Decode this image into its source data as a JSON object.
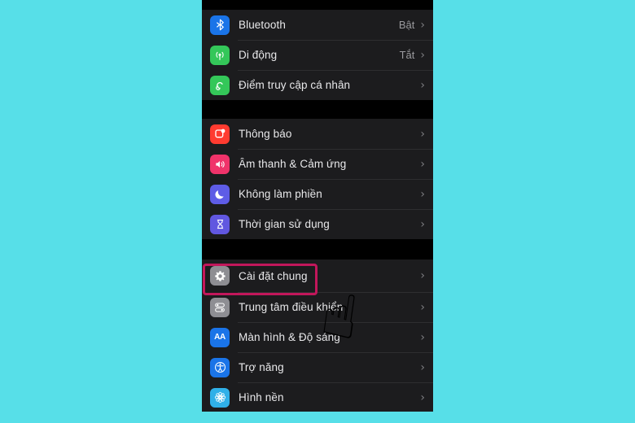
{
  "background": {
    "color": "#57dfe8"
  },
  "phone": {
    "panel_bg": "#000000",
    "group_bg": "#1c1c1e",
    "groups": [
      {
        "name": "connectivity",
        "rows": [
          {
            "label": "Bluetooth",
            "value": "Bật",
            "icon": "bluetooth-icon",
            "icon_color": "#1a74e8",
            "chevron": "›"
          },
          {
            "label": "Di động",
            "value": "Tắt",
            "icon": "cellular-icon",
            "icon_color": "#34c759",
            "chevron": "›"
          },
          {
            "label": "Điểm truy cập cá nhân",
            "value": "",
            "icon": "personal-hotspot-icon",
            "icon_color": "#34c759",
            "chevron": "›"
          }
        ]
      },
      {
        "name": "alerts",
        "rows": [
          {
            "label": "Thông báo",
            "value": "",
            "icon": "notifications-icon",
            "icon_color": "#ff3b30",
            "chevron": "›"
          },
          {
            "label": "Âm thanh & Cảm ứng",
            "value": "",
            "icon": "sounds-haptics-icon",
            "icon_color": "#f0336a",
            "chevron": "›"
          },
          {
            "label": "Không làm phiền",
            "value": "",
            "icon": "do-not-disturb-moon-icon",
            "icon_color": "#5e5ce6",
            "chevron": "›"
          },
          {
            "label": "Thời gian sử dụng",
            "value": "",
            "icon": "screen-time-hourglass-icon",
            "icon_color": "#6157e0",
            "chevron": "›"
          }
        ]
      },
      {
        "name": "system",
        "rows": [
          {
            "label": "Cài đặt chung",
            "value": "",
            "icon": "general-gear-icon",
            "icon_color": "#8e8e93",
            "chevron": "›"
          },
          {
            "label": "Trung tâm điều khiển",
            "value": "",
            "icon": "control-center-toggles-icon",
            "icon_color": "#8e8e93",
            "chevron": "›"
          },
          {
            "label": "Màn hình & Độ sáng",
            "value": "",
            "icon": "display-brightness-aa-icon",
            "icon_color": "#1a74e8",
            "chevron": "›"
          },
          {
            "label": "Trợ năng",
            "value": "",
            "icon": "accessibility-icon",
            "icon_color": "#1a74e8",
            "chevron": "›"
          },
          {
            "label": "Hình nền",
            "value": "",
            "icon": "wallpaper-flower-icon",
            "icon_color": "#30b0e8",
            "chevron": "›"
          }
        ]
      }
    ]
  },
  "annotations": {
    "highlight": {
      "name": "highlight-rectangle",
      "target_label": "Cài đặt chung",
      "color": "#c2175b"
    },
    "pointer": {
      "name": "pointing-hand",
      "glyph": "☝",
      "color": "#f6b73c"
    }
  }
}
